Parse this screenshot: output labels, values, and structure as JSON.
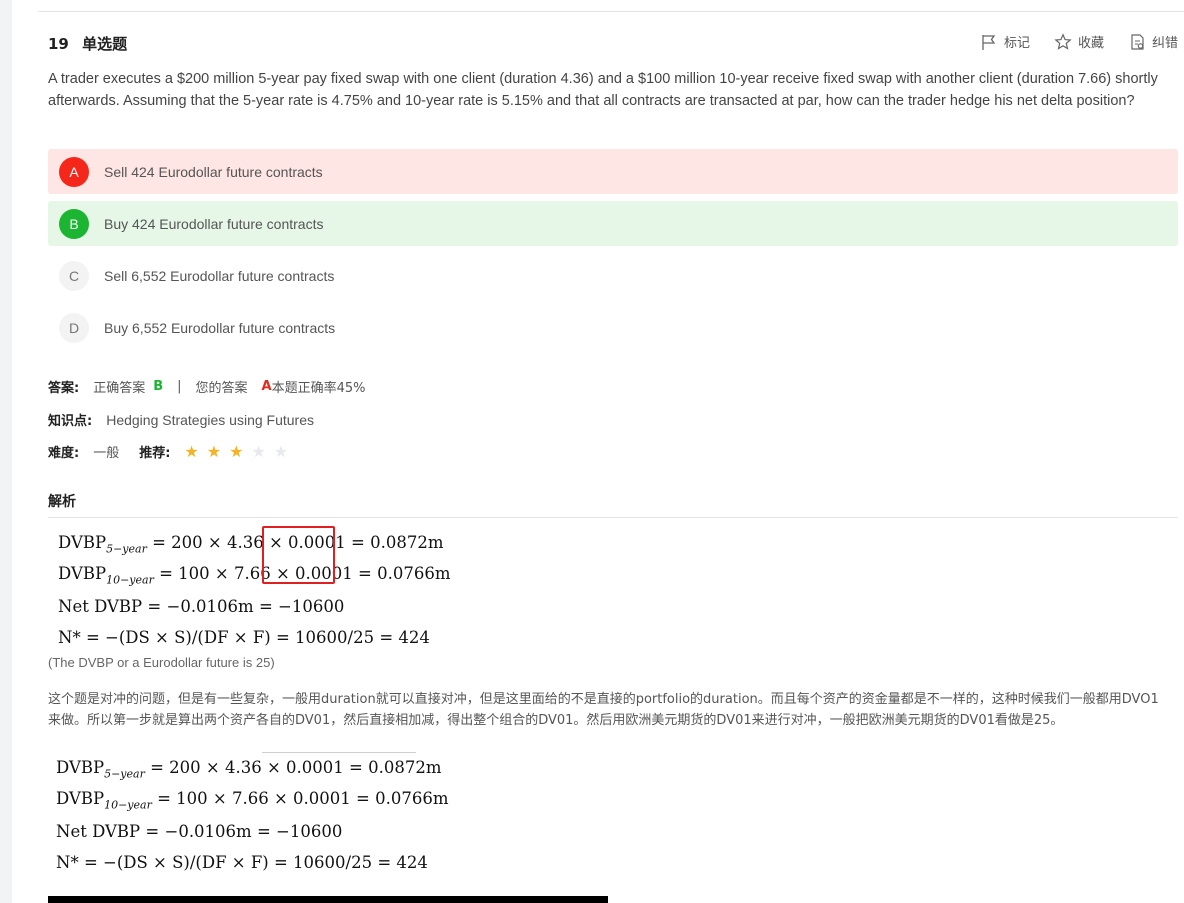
{
  "question": {
    "number": "19",
    "type": "单选题",
    "stem": "A trader executes a $200 million 5-year pay fixed swap with one client (duration 4.36) and a $100 million 10-year receive fixed swap with another client (duration 7.66) shortly afterwards. Assuming that the 5-year rate is 4.75% and 10-year rate is 5.15% and that all contracts are transacted at par, how can the trader hedge his net delta position?"
  },
  "toolbar": {
    "mark": "标记",
    "favorite": "收藏",
    "report": "纠错"
  },
  "options": [
    {
      "letter": "A",
      "text": "Sell 424 Eurodollar future contracts",
      "state": "wrong"
    },
    {
      "letter": "B",
      "text": "Buy 424 Eurodollar future contracts",
      "state": "correct"
    },
    {
      "letter": "C",
      "text": "Sell 6,552 Eurodollar future contracts",
      "state": "none"
    },
    {
      "letter": "D",
      "text": "Buy 6,552 Eurodollar future contracts",
      "state": "none"
    }
  ],
  "answer": {
    "label": "答案:",
    "correct_label": "正确答案",
    "correct": "B",
    "divider": "|",
    "yours_label": "您的答案",
    "yours": "A",
    "accuracy": "本题正确率45%"
  },
  "knowledge": {
    "label": "知识点:",
    "value": "Hedging Strategies using Futures"
  },
  "difficulty": {
    "label": "难度:",
    "value": "一般",
    "recommend_label": "推荐:",
    "stars": 3,
    "max_stars": 5
  },
  "analysis": {
    "title": "解析",
    "formulas": [
      {
        "lhs": "DVBP",
        "sub": "5−year",
        "rhs": "= 200 × 4.36 × 0.0001 = 0.0872m"
      },
      {
        "lhs": "DVBP",
        "sub": "10−year",
        "rhs": "= 100 × 7.66 × 0.0001 = 0.0766m"
      },
      {
        "lhs": "Net DVBP",
        "sub": "",
        "rhs": "= −0.0106m = −10600"
      },
      {
        "lhs": "N*",
        "sub": "",
        "rhs": "= −(DS × S)/(DF × F) = 10600/25 = 424"
      }
    ],
    "note": "(The DVBP or a Eurodollar future is 25)",
    "explanation": "这个题是对冲的问题，但是有一些复杂，一般用duration就可以直接对冲，但是这里面给的不是直接的portfolio的duration。而且每个资产的资金量都是不一样的，这种时候我们一般都用DVO1来做。所以第一步就是算出两个资产各自的DV01，然后直接相加减，得出整个组合的DV01。然后用欧洲美元期货的DV01来进行对冲，一般把欧洲美元期货的DV01看做是25。"
  },
  "colors": {
    "wrong": "#f5271b",
    "correct": "#1bb532",
    "star_on": "#f5b324",
    "star_off": "#e7e9ee"
  }
}
